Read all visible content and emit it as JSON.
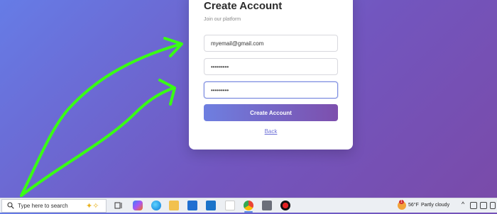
{
  "signup": {
    "title": "Create Account",
    "subtitle": "Join our platform",
    "email_value": "myemail@gmail.com",
    "password_value": "•••••••••",
    "confirm_password_value": "•••••••••",
    "submit_label": "Create Account",
    "back_label": "Back"
  },
  "annotation": {
    "color": "#39ff14",
    "shape": "arrows"
  },
  "taskbar": {
    "search_placeholder": "Type here to search",
    "apps": [
      "sparkle-icon",
      "task-view-icon",
      "copilot-icon",
      "edge-icon",
      "file-explorer-icon",
      "store-icon",
      "outlook-icon",
      "paint-icon",
      "chrome-icon",
      "game-icon",
      "record-icon"
    ],
    "weather": {
      "temp": "56°F",
      "condition": "Partly cloudy",
      "alert_count": "1"
    }
  },
  "colors": {
    "background_start": "#667ce6",
    "background_end": "#7a4aa8",
    "button_start": "#6e7fe0",
    "button_end": "#7d4fad",
    "link": "#6f72d8"
  }
}
